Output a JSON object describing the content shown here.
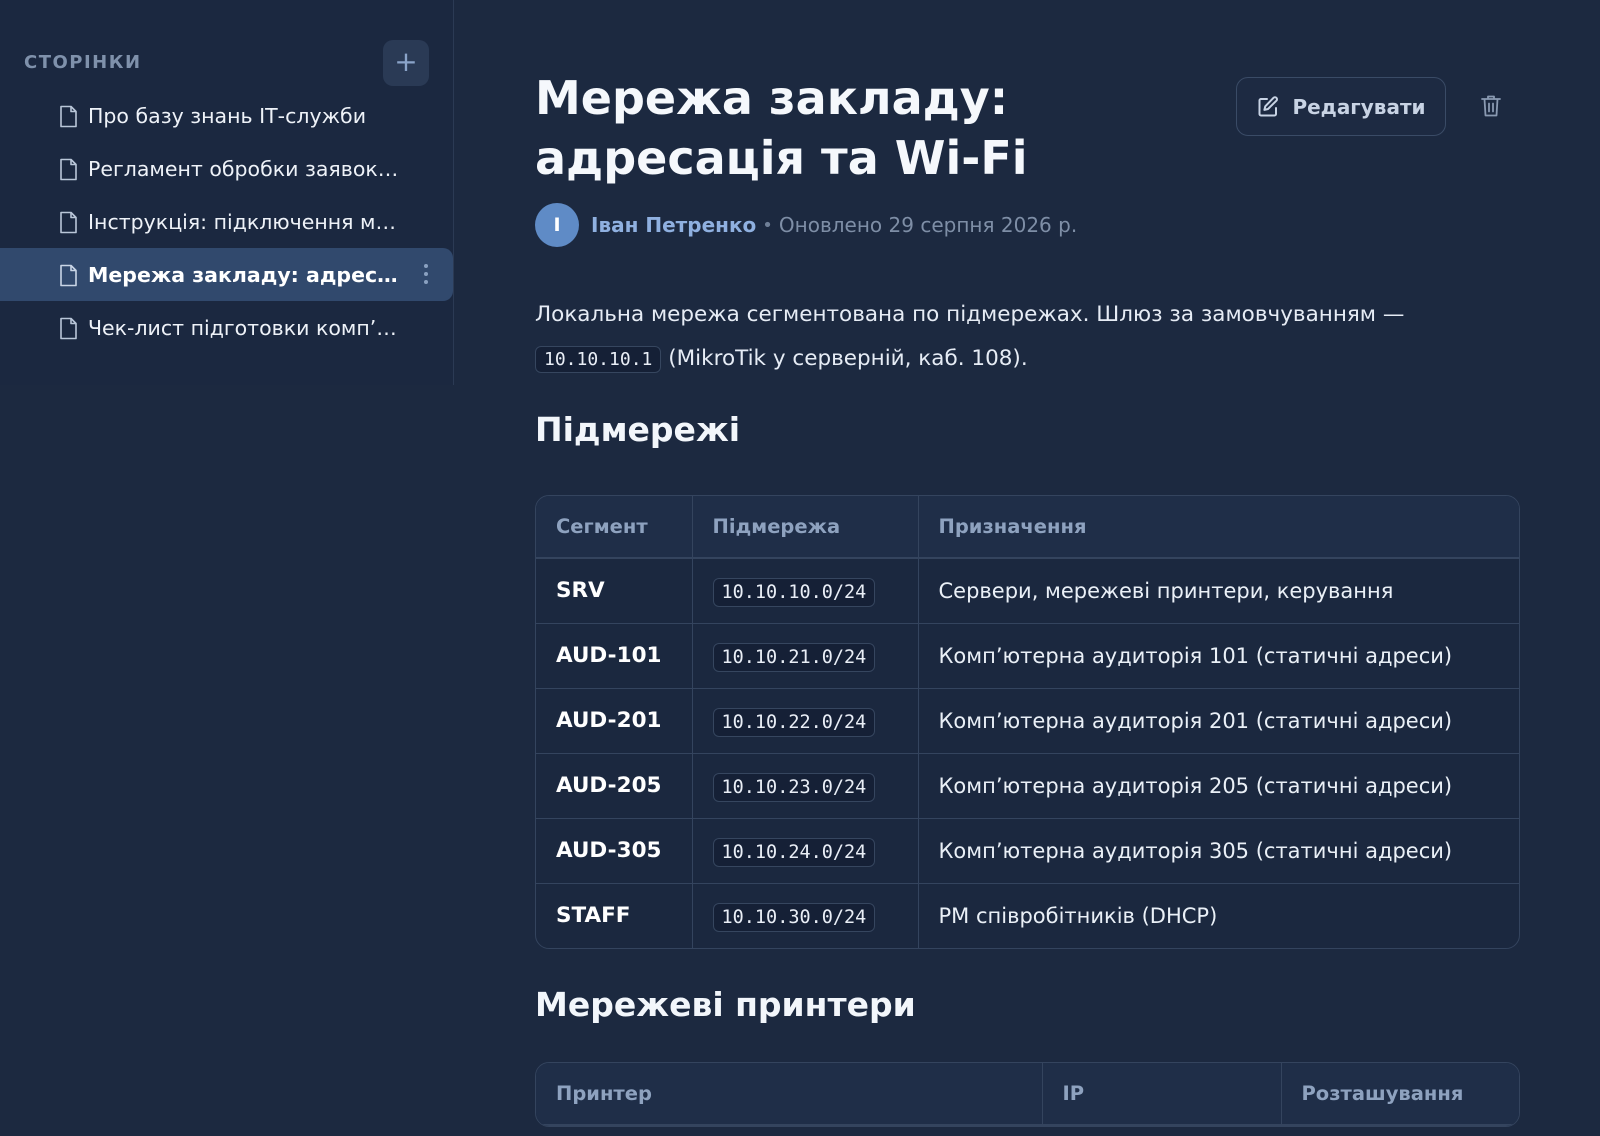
{
  "sidebar": {
    "title": "СТОРІНКИ",
    "add_label": "+",
    "items": [
      {
        "label": "Про базу знань ІТ-служби",
        "active": false
      },
      {
        "label": "Регламент обробки заявок …",
        "active": false
      },
      {
        "label": "Інструкція: підключення ме…",
        "active": false
      },
      {
        "label": "Мережа закладу: адресац…",
        "active": true
      },
      {
        "label": "Чек-лист підготовки комп’…",
        "active": false
      }
    ]
  },
  "page": {
    "title": "Мережа закладу: адресація та Wi-Fi",
    "edit_label": "Редагувати",
    "author_initial": "І",
    "author": "Іван Петренко",
    "separator": "•",
    "updated": "Оновлено 29 серпня 2026 р.",
    "intro_text_1": "Локальна мережа сегментована по підмережах. Шлюз за замовчуванням —",
    "intro_code": "10.10.10.1",
    "intro_text_2": "(MikroTik у серверній, каб. 108)."
  },
  "subnets": {
    "heading": "Підмережі",
    "headers": [
      "Сегмент",
      "Підмережа",
      "Призначення"
    ],
    "rows": [
      [
        "SRV",
        "10.10.10.0/24",
        "Сервери, мережеві принтери, керування"
      ],
      [
        "AUD-101",
        "10.10.21.0/24",
        "Комп’ютерна аудиторія 101 (статичні адреси)"
      ],
      [
        "AUD-201",
        "10.10.22.0/24",
        "Комп’ютерна аудиторія 201 (статичні адреси)"
      ],
      [
        "AUD-205",
        "10.10.23.0/24",
        "Комп’ютерна аудиторія 205 (статичні адреси)"
      ],
      [
        "AUD-305",
        "10.10.24.0/24",
        "Комп’ютерна аудиторія 305 (статичні адреси)"
      ],
      [
        "STAFF",
        "10.10.30.0/24",
        "РМ співробітників (DHCP)"
      ]
    ]
  },
  "printers": {
    "heading": "Мережеві принтери",
    "headers": [
      "Принтер",
      "IP",
      "Розташування"
    ]
  },
  "icons": {
    "page": "document-icon",
    "more": "more-vertical-icon",
    "edit": "edit-icon",
    "delete": "trash-icon"
  },
  "colors": {
    "background": "#1c2940",
    "active_item": "#31496d",
    "accent": "#8fb0e0",
    "avatar": "#5f8bc6"
  }
}
